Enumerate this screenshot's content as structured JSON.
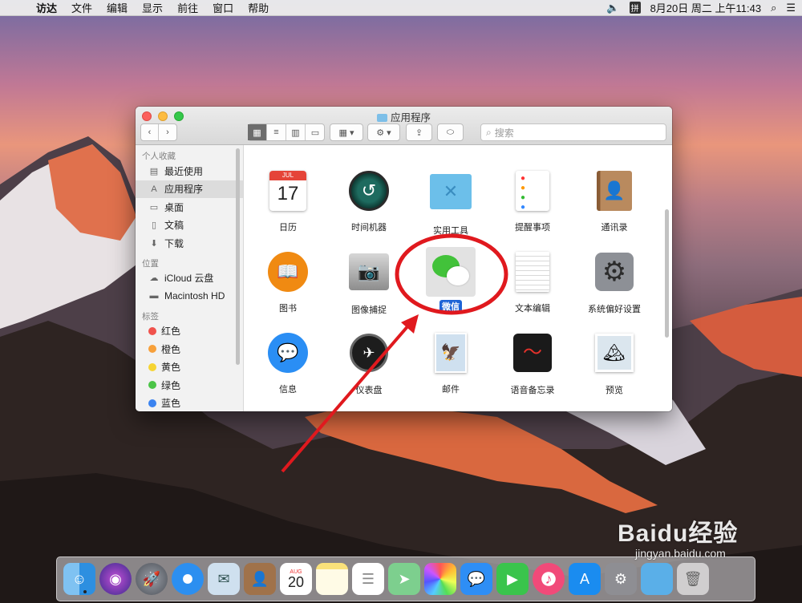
{
  "menubar": {
    "items": [
      "访达",
      "文件",
      "编辑",
      "显示",
      "前往",
      "窗口",
      "帮助"
    ],
    "clock": "8月20日 周二 上午11:43"
  },
  "window": {
    "title": "应用程序",
    "search_placeholder": "搜索",
    "sidebar": {
      "favorites_header": "个人收藏",
      "favorites": [
        "最近使用",
        "应用程序",
        "桌面",
        "文稿",
        "下载"
      ],
      "locations_header": "位置",
      "locations": [
        "iCloud 云盘",
        "Macintosh HD"
      ],
      "tags_header": "标签",
      "tags": [
        {
          "label": "红色",
          "color": "#f0524c"
        },
        {
          "label": "橙色",
          "color": "#f7a03a"
        },
        {
          "label": "黄色",
          "color": "#f6d433"
        },
        {
          "label": "绿色",
          "color": "#4bc447"
        },
        {
          "label": "蓝色",
          "color": "#3b83f0"
        }
      ]
    },
    "apps": [
      {
        "label": "日历",
        "icon": "calendar-icon"
      },
      {
        "label": "时间机器",
        "icon": "time-machine-icon"
      },
      {
        "label": "实用工具",
        "icon": "utilities-folder-icon"
      },
      {
        "label": "提醒事项",
        "icon": "reminders-icon"
      },
      {
        "label": "通讯录",
        "icon": "contacts-icon"
      },
      {
        "label": "图书",
        "icon": "books-icon"
      },
      {
        "label": "图像捕捉",
        "icon": "image-capture-icon"
      },
      {
        "label": "微信",
        "icon": "wechat-icon",
        "selected": true
      },
      {
        "label": "文本编辑",
        "icon": "textedit-icon"
      },
      {
        "label": "系统偏好设置",
        "icon": "system-preferences-icon"
      },
      {
        "label": "信息",
        "icon": "messages-icon"
      },
      {
        "label": "仪表盘",
        "icon": "dashboard-icon"
      },
      {
        "label": "邮件",
        "icon": "mail-icon"
      },
      {
        "label": "语音备忘录",
        "icon": "voice-memos-icon"
      },
      {
        "label": "预览",
        "icon": "preview-icon"
      }
    ],
    "calendar_icon": {
      "month": "JUL",
      "day": "17"
    }
  },
  "dock": {
    "calendar_icon": {
      "month": "AUG",
      "day": "20"
    }
  },
  "watermark": {
    "logo": "Baidu经验",
    "url": "jingyan.baidu.com"
  }
}
